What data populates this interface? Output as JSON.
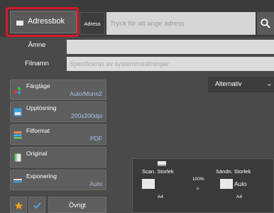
{
  "header": {
    "address_book_label": "Adressbok",
    "address_button_label": "Adress",
    "address_placeholder": "Tryck för att ange adress",
    "search_icon": "search-icon"
  },
  "fields": {
    "subject_label": "Ämne",
    "subject_value": "",
    "filename_label": "Filnamn",
    "filename_placeholder": "Specificeras av systeminställningar"
  },
  "options_tab": {
    "label": "Alternativ",
    "icon": "chevron-down-icon"
  },
  "functions": [
    {
      "label": "Färgläge",
      "value": "Auto/Mono2",
      "icon": "color-mode-icon"
    },
    {
      "label": "Upplösning",
      "value": "200x200dpi",
      "icon": "resolution-icon"
    },
    {
      "label": "Filformat",
      "value": "PDF",
      "icon": "file-format-icon"
    },
    {
      "label": "Original",
      "value": "",
      "icon": "original-icon"
    },
    {
      "label": "Exponering",
      "value": "Auto",
      "icon": "exposure-icon"
    }
  ],
  "scan_panel": {
    "scan_size_label": "Scan. Storlek",
    "ratio": "100%",
    "send_size_label": "Sändn. Storlek",
    "send_size_value": "Auto",
    "scan_paper": "A4",
    "send_paper": "A4"
  },
  "bottom": {
    "other_label": "Övrigt",
    "star_icon": "star-icon",
    "check_icon": "check-icon"
  },
  "colors": {
    "highlight": "#d6182a",
    "value_text": "#a8c4e6",
    "star": "#f0a020",
    "check": "#4aa6e6"
  }
}
